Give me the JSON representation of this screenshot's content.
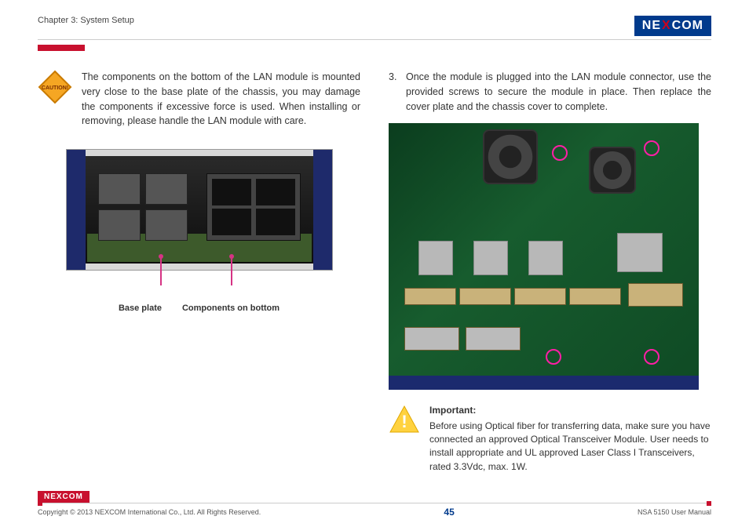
{
  "header": {
    "chapter": "Chapter 3: System Setup",
    "logo_left": "NE",
    "logo_x": "X",
    "logo_right": "COM"
  },
  "left": {
    "caution_text": "The components on the bottom of the LAN module is mounted very close to the base plate of the chassis, you may damage the components if excessive force is used. When installing or removing, please handle the LAN module with care.",
    "label_baseplate": "Base plate",
    "label_components": "Components on bottom"
  },
  "right": {
    "step_num": "3.",
    "step_text": "Once the module is plugged into the LAN module connector, use the provided screws to secure the module in place. Then replace the cover plate and the chassis cover to complete.",
    "important_label": "Important:",
    "important_text": "Before using Optical fiber for transferring data, make sure you have connected an approved Optical Transceiver Module. User needs to install appropriate and UL approved Laser Class I Transceivers, rated 3.3Vdc, max. 1W."
  },
  "footer": {
    "logo": "NEXCOM",
    "copyright": "Copyright © 2013 NEXCOM International Co., Ltd. All Rights Reserved.",
    "page": "45",
    "manual": "NSA 5150 User Manual"
  }
}
